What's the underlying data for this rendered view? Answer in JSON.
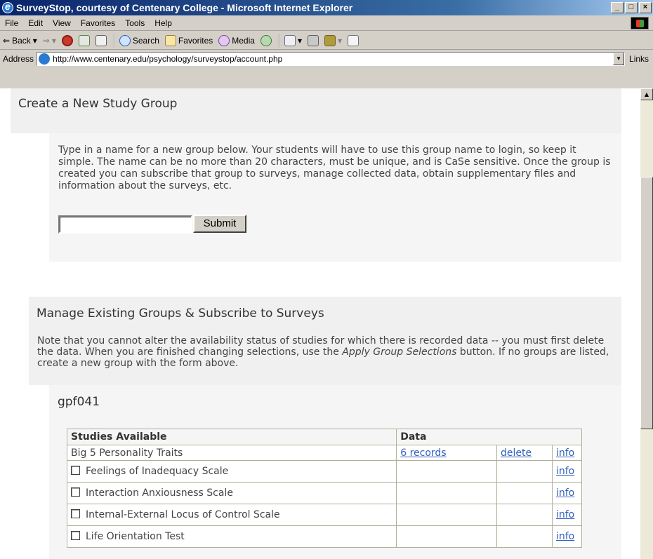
{
  "window": {
    "title": "SurveyStop, courtesy of Centenary College - Microsoft Internet Explorer",
    "controls": [
      "_",
      "□",
      "×"
    ]
  },
  "menu": [
    "File",
    "Edit",
    "View",
    "Favorites",
    "Tools",
    "Help"
  ],
  "toolbar": {
    "back": "Back",
    "search": "Search",
    "favorites": "Favorites",
    "media": "Media"
  },
  "address": {
    "label": "Address",
    "url": "http://www.centenary.edu/psychology/surveystop/account.php",
    "links": "Links"
  },
  "create_group": {
    "heading": "Create a New Study Group",
    "description": "Type in a name for a new group below. Your students will have to use this group name to login, so keep it simple. The name can be no more than 20 characters, must be unique, and is CaSe sensitive. Once the group is created you can subscribe that group to surveys, manage collected data, obtain supplementary files and information about the surveys, etc.",
    "input_value": "",
    "submit_label": "Submit"
  },
  "manage_groups": {
    "heading": "Manage Existing Groups & Subscribe to Surveys",
    "desc_part1": "Note that you cannot alter the availability status of studies for which there is recorded data -- you must first delete the data. When you are finished changing selections, use the ",
    "desc_emph": "Apply Group Selections",
    "desc_part2": " button. If no groups are listed, create a new group with the form above."
  },
  "group": {
    "name": "gpf041",
    "headers": {
      "studies": "Studies Available",
      "data": "Data"
    },
    "rows": [
      {
        "name": "Big 5 Personality Traits",
        "records": "6 records",
        "delete": "delete",
        "info": "info",
        "has_checkbox": false
      },
      {
        "name": "Feelings of Inadequacy Scale",
        "info": "info",
        "has_checkbox": true
      },
      {
        "name": "Interaction Anxiousness Scale",
        "info": "info",
        "has_checkbox": true
      },
      {
        "name": "Internal-External Locus of Control Scale",
        "info": "info",
        "has_checkbox": true
      },
      {
        "name": "Life Orientation Test",
        "info": "info",
        "has_checkbox": true
      }
    ]
  }
}
